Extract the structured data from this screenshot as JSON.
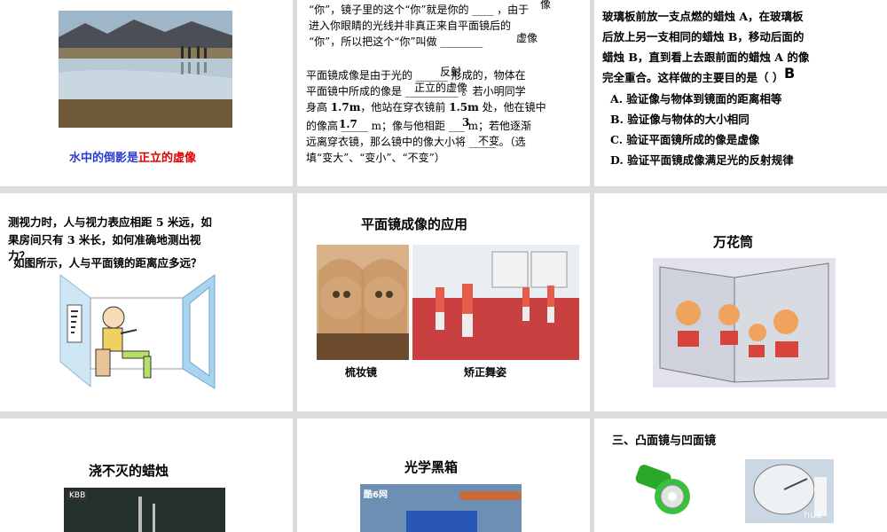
{
  "slides": {
    "s1": {
      "caption_part1": "水中的倒影是",
      "caption_part2": "正立的虚像"
    },
    "s2": {
      "p1_line1": "“你”，镜子里的这个“你”就是你的 ____ ，由于",
      "p1_line2": "进入你眼睛的光线并非真正来自平面镜后的",
      "p1_line3": "“你”，所以把这个“你”叫做 ________",
      "ans_image": "像",
      "ans_virtual": "虚像",
      "p2_line1": "平面镜成像是由于光的 ______ 形成的，物体在",
      "p2_line2": "平面镜中所成的像是 __________ 。若小明同学",
      "p2_line3_a": "身高 ",
      "p2_line3_b": "1.7m",
      "p2_line3_c": "，他站在穿衣镜前 ",
      "p2_line3_d": "1.5m",
      "p2_line3_e": " 处，他在镜中",
      "p2_line4": "的像高 _____ m；像与他相距 ___ m；若他逐渐",
      "p2_line5": "远离穿衣镜，那么镜中的像大小将 _____ 。（选",
      "p2_line6": "填“变大”、“变小”、“不变”）",
      "ans_reflection": "反射",
      "ans_upright_virtual": "正立的虚像",
      "ans_height": "1.7",
      "ans_distance": "3",
      "ans_unchanged": "不变"
    },
    "s3": {
      "line1": "玻璃板前放一支点燃的蜡烛 A，在玻璃板",
      "line2": "后放上另一支相同的蜡烛 B，移动后面的",
      "line3": "蜡烛 B，直到看上去跟前面的蜡烛 A 的像",
      "line4": "完全重合。这样做的主要目的是（    ）",
      "answer": "B",
      "options": [
        "A. 验证像与物体到镜面的距离相等",
        "B. 验证像与物体的大小相同",
        "C. 验证平面镜所成的像是虚像",
        "D. 验证平面镜成像满足光的反射规律"
      ]
    },
    "s4": {
      "line1": "测视力时，人与视力表应相距 5 米远，如",
      "line2": "果房间只有 3 米长，如何准确地测出视",
      "line3": "力？",
      "line4": "如图所示，人与平面镜的距离应多远？"
    },
    "s5": {
      "title": "平面镜成像的应用",
      "cap_left": "梳妆镜",
      "cap_right": "矫正舞姿"
    },
    "s6": {
      "title": "万花筒"
    },
    "s7": {
      "title": "浇不灭的蜡烛",
      "logo": "KBB"
    },
    "s8": {
      "title": "光学黑箱",
      "logo": "酷6网"
    },
    "s9": {
      "title": "三、凸面镜与凹面镜",
      "watermark": "hua"
    }
  }
}
